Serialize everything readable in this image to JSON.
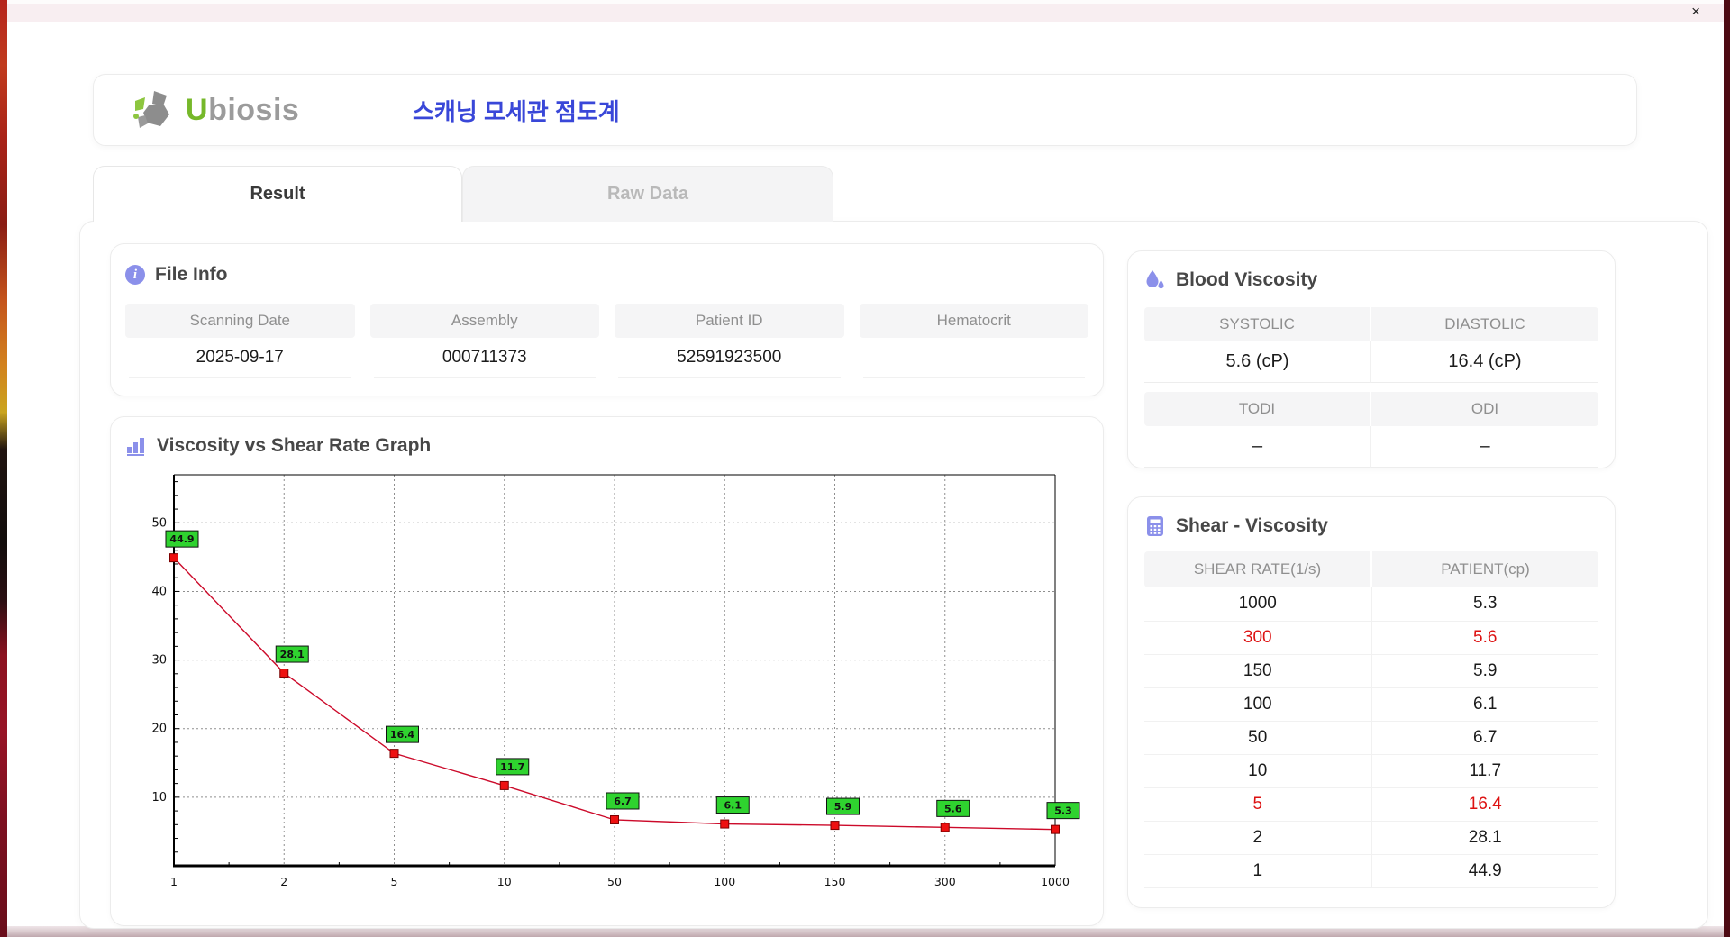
{
  "window": {
    "close_label": "×"
  },
  "header": {
    "brand_prefix": "U",
    "brand_rest": "biosis",
    "title_ko": "스캐닝 모세관 점도계"
  },
  "tabs": [
    {
      "label": "Result",
      "active": true
    },
    {
      "label": "Raw Data",
      "active": false
    }
  ],
  "file_info": {
    "title": "File Info",
    "info_glyph": "i",
    "fields": [
      {
        "label": "Scanning Date",
        "value": "2025-09-17"
      },
      {
        "label": "Assembly",
        "value": "000711373"
      },
      {
        "label": "Patient ID",
        "value": "52591923500"
      },
      {
        "label": "Hematocrit",
        "value": ""
      }
    ]
  },
  "blood_viscosity": {
    "title": "Blood Viscosity",
    "row1_labels": [
      "SYSTOLIC",
      "DIASTOLIC"
    ],
    "row1_values": [
      "5.6 (cP)",
      "16.4 (cP)"
    ],
    "row2_labels": [
      "TODI",
      "ODI"
    ],
    "row2_values": [
      "–",
      "–"
    ]
  },
  "shear_viscosity": {
    "title": "Shear - Viscosity",
    "columns": [
      "SHEAR RATE(1/s)",
      "PATIENT(cp)"
    ],
    "rows": [
      {
        "rate": "1000",
        "patient": "5.3",
        "highlight": false
      },
      {
        "rate": "300",
        "patient": "5.6",
        "highlight": true
      },
      {
        "rate": "150",
        "patient": "5.9",
        "highlight": false
      },
      {
        "rate": "100",
        "patient": "6.1",
        "highlight": false
      },
      {
        "rate": "50",
        "patient": "6.7",
        "highlight": false
      },
      {
        "rate": "10",
        "patient": "11.7",
        "highlight": false
      },
      {
        "rate": "5",
        "patient": "16.4",
        "highlight": true
      },
      {
        "rate": "2",
        "patient": "28.1",
        "highlight": false
      },
      {
        "rate": "1",
        "patient": "44.9",
        "highlight": false
      }
    ]
  },
  "graph_section": {
    "title": "Viscosity vs Shear Rate Graph"
  },
  "chart_data": {
    "type": "line",
    "title": "Viscosity vs Shear Rate Graph",
    "x_scale": "categorical",
    "x": [
      1,
      2,
      5,
      10,
      50,
      100,
      150,
      300,
      1000
    ],
    "x_labels": [
      "1",
      "2",
      "5",
      "10",
      "50",
      "100",
      "150",
      "300",
      "1000"
    ],
    "values": [
      44.9,
      28.1,
      16.4,
      11.7,
      6.7,
      6.1,
      5.9,
      5.6,
      5.3
    ],
    "point_labels": [
      "44.9",
      "28.1",
      "16.4",
      "11.7",
      "6.7",
      "6.1",
      "5.9",
      "5.6",
      "5.3"
    ],
    "series_name": "PATIENT(cp)",
    "xlabel": "",
    "ylabel": "",
    "yticks": [
      10,
      20,
      30,
      40,
      50
    ],
    "ylim": [
      0,
      57
    ],
    "grid": true,
    "legend_position": "none",
    "line_color": "#cc0a2a",
    "marker_color": "#ee1111",
    "marker_border": "#7d0000",
    "label_bg": "#2fd32f",
    "label_border": "#111111"
  },
  "colors": {
    "accent_purple": "#8b90ea",
    "brand_green": "#76b82a",
    "brand_gray": "#9b9b9b",
    "title_blue": "#3947d8",
    "highlight_red": "#dd1111",
    "table_header_bg": "#f5f5f6"
  }
}
